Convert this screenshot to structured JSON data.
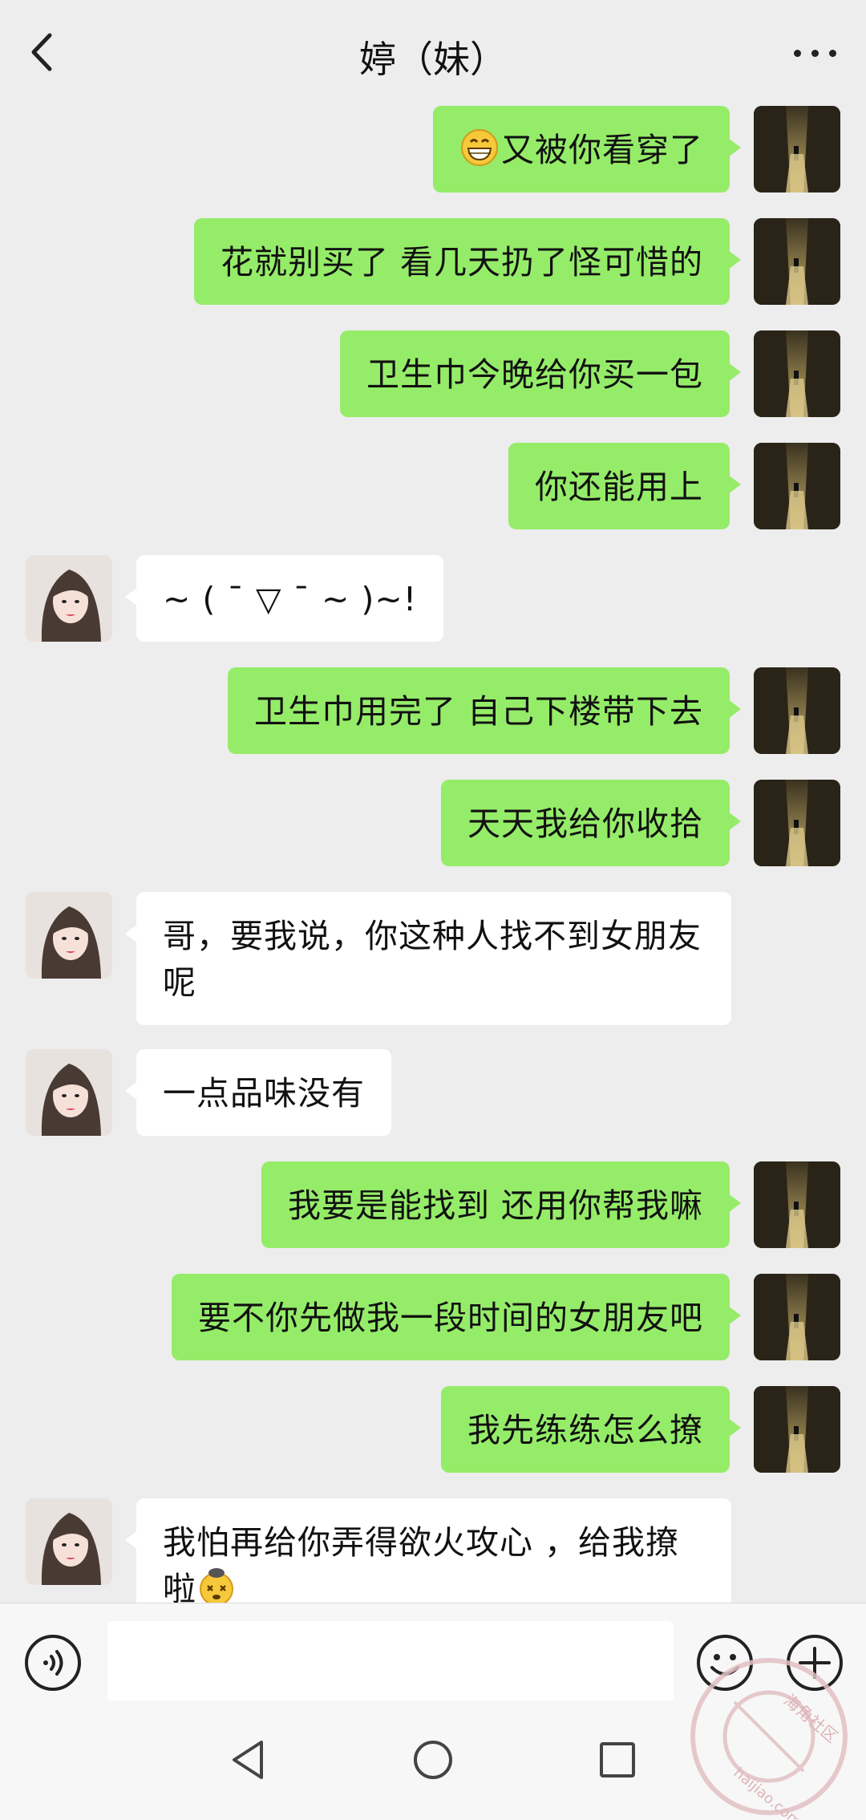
{
  "header": {
    "title": "婷（妹）",
    "back_icon": "chevron-left-icon",
    "more_icon": "more-dots-icon"
  },
  "messages": [
    {
      "from": "me",
      "text": "又被你看穿了",
      "emoji": "grinning-face-emoji"
    },
    {
      "from": "me",
      "text": "花就别买了 看几天扔了怪可惜的"
    },
    {
      "from": "me",
      "text": "卫生巾今晚给你买一包"
    },
    {
      "from": "me",
      "text": "你还能用上"
    },
    {
      "from": "them",
      "text": "~ ( ˉ ▽ ˉ ~ )~!"
    },
    {
      "from": "me",
      "text": "卫生巾用完了 自己下楼带下去"
    },
    {
      "from": "me",
      "text": "天天我给你收拾"
    },
    {
      "from": "them",
      "text": "哥，要我说，你这种人找不到女朋友呢"
    },
    {
      "from": "them",
      "text": "一点品味没有"
    },
    {
      "from": "me",
      "text": "我要是能找到 还用你帮我嘛"
    },
    {
      "from": "me",
      "text": "要不你先做我一段时间的女朋友吧"
    },
    {
      "from": "me",
      "text": "我先练练怎么撩"
    },
    {
      "from": "them",
      "text": "我怕再给你弄得欲火攻心 ，给我撩啦",
      "emoji": "dizzy-face-emoji"
    }
  ],
  "input_bar": {
    "placeholder": "",
    "voice_icon": "voice-icon",
    "emoji_icon": "emoji-icon",
    "plus_icon": "plus-circle-icon"
  },
  "nav_bar": {
    "back_icon": "nav-back-icon",
    "home_icon": "nav-home-icon",
    "recents_icon": "nav-recents-icon"
  },
  "watermark": {
    "line1": "海角社区",
    "line2": "haijiao.com"
  },
  "colors": {
    "background": "#ededed",
    "my_bubble": "#95ec69",
    "their_bubble": "#ffffff"
  }
}
